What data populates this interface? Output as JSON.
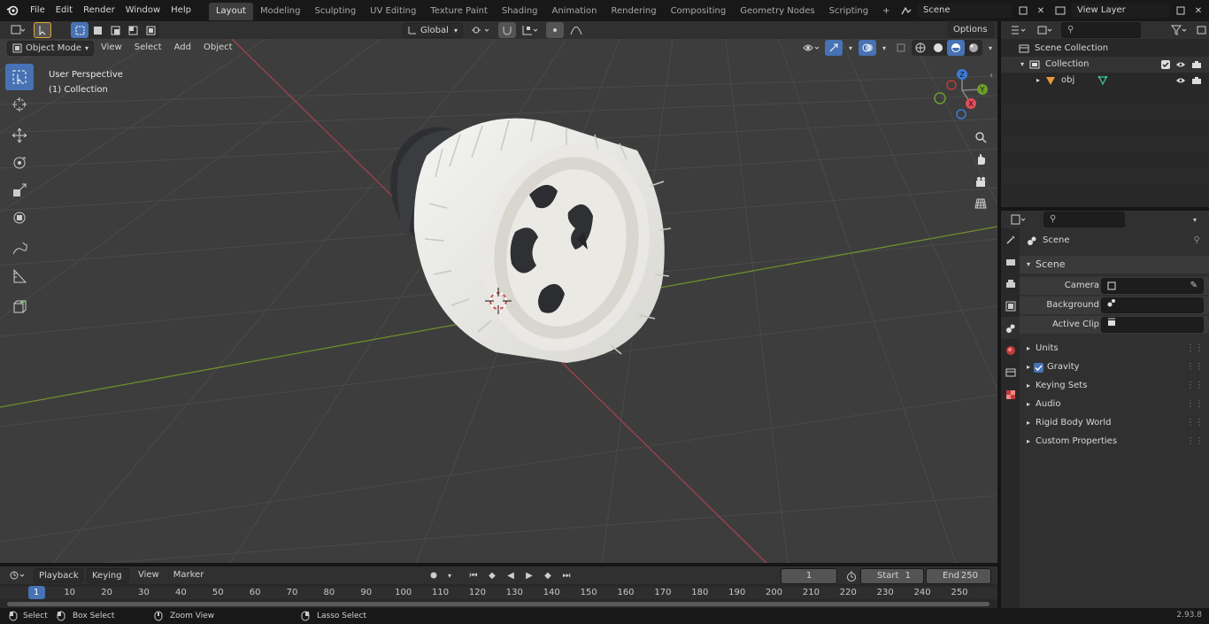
{
  "menu": [
    "File",
    "Edit",
    "Render",
    "Window",
    "Help"
  ],
  "workspaces": [
    "Layout",
    "Modeling",
    "Sculpting",
    "UV Editing",
    "Texture Paint",
    "Shading",
    "Animation",
    "Rendering",
    "Compositing",
    "Geometry Nodes",
    "Scripting"
  ],
  "active_workspace": "Layout",
  "scene_field": "Scene",
  "view_layer_field": "View Layer",
  "viewport_header": {
    "mode": "Object Mode",
    "view": "View",
    "select": "Select",
    "add": "Add",
    "object": "Object",
    "orientation": "Global",
    "options": "Options"
  },
  "viewport_overlay": {
    "line1": "User Perspective",
    "line2": "(1) Collection"
  },
  "gizmo": {
    "x": "X",
    "y": "Y",
    "z": "Z"
  },
  "outliner": {
    "scene_collection": "Scene Collection",
    "collection": "Collection",
    "object": "obj"
  },
  "properties": {
    "context": "Scene",
    "panel": "Scene",
    "camera_label": "Camera",
    "bg_scene_label": "Background Scene",
    "active_clip_label": "Active Clip",
    "subpanels": [
      "Units",
      "Gravity",
      "Keying Sets",
      "Audio",
      "Rigid Body World",
      "Custom Properties"
    ]
  },
  "timeline": {
    "playback": "Playback",
    "keying": "Keying",
    "view": "View",
    "marker": "Marker",
    "current_frame": "1",
    "start_label": "Start",
    "start": "1",
    "end_label": "End",
    "end": "250",
    "ticks": [
      "1",
      "10",
      "20",
      "30",
      "40",
      "50",
      "60",
      "70",
      "80",
      "90",
      "100",
      "110",
      "120",
      "130",
      "140",
      "150",
      "160",
      "170",
      "180",
      "190",
      "200",
      "210",
      "220",
      "230",
      "240",
      "250"
    ]
  },
  "status": {
    "select": "Select",
    "box_select": "Box Select",
    "zoom_view": "Zoom View",
    "lasso_select": "Lasso Select",
    "version": "2.93.8"
  },
  "colors": {
    "accent": "#4772b3",
    "x_axis": "#a3404f",
    "y_axis": "#6d8e2b",
    "z_axis": "#3c7bd9"
  }
}
